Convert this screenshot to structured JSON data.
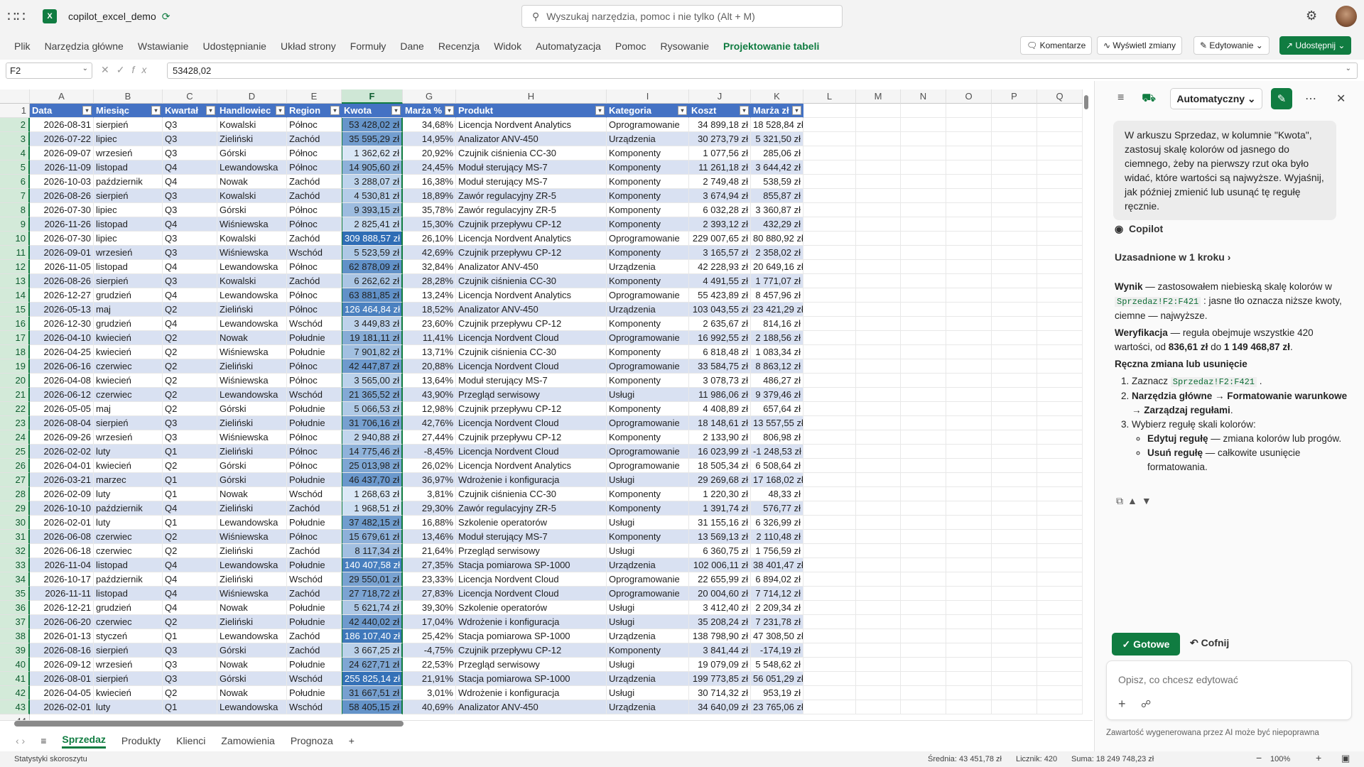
{
  "app": {
    "title": "copilot_excel_demo",
    "search_placeholder": "Wyszukaj narzędzia, pomoc i nie tylko (Alt + M)"
  },
  "ribbon": {
    "tabs": [
      "Plik",
      "Narzędzia główne",
      "Wstawianie",
      "Udostępnianie",
      "Układ strony",
      "Formuły",
      "Dane",
      "Recenzja",
      "Widok",
      "Automatyzacja",
      "Pomoc",
      "Rysowanie",
      "Projektowanie tabeli"
    ],
    "active_tab": "Projektowanie tabeli",
    "comments": "Komentarze",
    "show_changes": "Wyświetl zmiany",
    "editing": "Edytowanie",
    "share": "Udostępnij"
  },
  "formula": {
    "name_box": "F2",
    "value": "53428,02"
  },
  "columns": [
    "A",
    "B",
    "C",
    "D",
    "E",
    "F",
    "G",
    "H",
    "I",
    "J",
    "K",
    "L",
    "M",
    "N",
    "O",
    "P",
    "Q"
  ],
  "headers": [
    "Data",
    "Miesiąc",
    "Kwartał",
    "Handlowiec",
    "Region",
    "Kwota",
    "Marża %",
    "Produkt",
    "Kategoria",
    "Koszt",
    "Marża zł"
  ],
  "rows": [
    [
      "2026-08-31",
      "sierpień",
      "Q3",
      "Kowalski",
      "Północ",
      "53 428,02 zł",
      "34,68%",
      "Licencja Nordvent Analytics",
      "Oprogramowanie",
      "34 899,18 zł",
      "18 528,84 zł"
    ],
    [
      "2026-07-22",
      "lipiec",
      "Q3",
      "Zieliński",
      "Zachód",
      "35 595,29 zł",
      "14,95%",
      "Analizator ANV-450",
      "Urządzenia",
      "30 273,79 zł",
      "5 321,50 zł"
    ],
    [
      "2026-09-07",
      "wrzesień",
      "Q3",
      "Górski",
      "Północ",
      "1 362,62 zł",
      "20,92%",
      "Czujnik ciśnienia CC-30",
      "Komponenty",
      "1 077,56 zł",
      "285,06 zł"
    ],
    [
      "2026-11-09",
      "listopad",
      "Q4",
      "Lewandowska",
      "Północ",
      "14 905,60 zł",
      "24,45%",
      "Moduł sterujący MS-7",
      "Komponenty",
      "11 261,18 zł",
      "3 644,42 zł"
    ],
    [
      "2026-10-03",
      "październik",
      "Q4",
      "Nowak",
      "Zachód",
      "3 288,07 zł",
      "16,38%",
      "Moduł sterujący MS-7",
      "Komponenty",
      "2 749,48 zł",
      "538,59 zł"
    ],
    [
      "2026-08-26",
      "sierpień",
      "Q3",
      "Kowalski",
      "Zachód",
      "4 530,81 zł",
      "18,89%",
      "Zawór regulacyjny ZR-5",
      "Komponenty",
      "3 674,94 zł",
      "855,87 zł"
    ],
    [
      "2026-07-30",
      "lipiec",
      "Q3",
      "Górski",
      "Północ",
      "9 393,15 zł",
      "35,78%",
      "Zawór regulacyjny ZR-5",
      "Komponenty",
      "6 032,28 zł",
      "3 360,87 zł"
    ],
    [
      "2026-11-26",
      "listopad",
      "Q4",
      "Wiśniewska",
      "Północ",
      "2 825,41 zł",
      "15,30%",
      "Czujnik przepływu CP-12",
      "Komponenty",
      "2 393,12 zł",
      "432,29 zł"
    ],
    [
      "2026-07-30",
      "lipiec",
      "Q3",
      "Kowalski",
      "Zachód",
      "309 888,57 zł",
      "26,10%",
      "Licencja Nordvent Analytics",
      "Oprogramowanie",
      "229 007,65 zł",
      "80 880,92 zł"
    ],
    [
      "2026-09-01",
      "wrzesień",
      "Q3",
      "Wiśniewska",
      "Wschód",
      "5 523,59 zł",
      "42,69%",
      "Czujnik przepływu CP-12",
      "Komponenty",
      "3 165,57 zł",
      "2 358,02 zł"
    ],
    [
      "2026-11-05",
      "listopad",
      "Q4",
      "Lewandowska",
      "Północ",
      "62 878,09 zł",
      "32,84%",
      "Analizator ANV-450",
      "Urządzenia",
      "42 228,93 zł",
      "20 649,16 zł"
    ],
    [
      "2026-08-26",
      "sierpień",
      "Q3",
      "Kowalski",
      "Zachód",
      "6 262,62 zł",
      "28,28%",
      "Czujnik ciśnienia CC-30",
      "Komponenty",
      "4 491,55 zł",
      "1 771,07 zł"
    ],
    [
      "2026-12-27",
      "grudzień",
      "Q4",
      "Lewandowska",
      "Północ",
      "63 881,85 zł",
      "13,24%",
      "Licencja Nordvent Analytics",
      "Oprogramowanie",
      "55 423,89 zł",
      "8 457,96 zł"
    ],
    [
      "2026-05-13",
      "maj",
      "Q2",
      "Zieliński",
      "Północ",
      "126 464,84 zł",
      "18,52%",
      "Analizator ANV-450",
      "Urządzenia",
      "103 043,55 zł",
      "23 421,29 zł"
    ],
    [
      "2026-12-30",
      "grudzień",
      "Q4",
      "Lewandowska",
      "Wschód",
      "3 449,83 zł",
      "23,60%",
      "Czujnik przepływu CP-12",
      "Komponenty",
      "2 635,67 zł",
      "814,16 zł"
    ],
    [
      "2026-04-10",
      "kwiecień",
      "Q2",
      "Nowak",
      "Południe",
      "19 181,11 zł",
      "11,41%",
      "Licencja Nordvent Cloud",
      "Oprogramowanie",
      "16 992,55 zł",
      "2 188,56 zł"
    ],
    [
      "2026-04-25",
      "kwiecień",
      "Q2",
      "Wiśniewska",
      "Południe",
      "7 901,82 zł",
      "13,71%",
      "Czujnik ciśnienia CC-30",
      "Komponenty",
      "6 818,48 zł",
      "1 083,34 zł"
    ],
    [
      "2026-06-16",
      "czerwiec",
      "Q2",
      "Zieliński",
      "Północ",
      "42 447,87 zł",
      "20,88%",
      "Licencja Nordvent Cloud",
      "Oprogramowanie",
      "33 584,75 zł",
      "8 863,12 zł"
    ],
    [
      "2026-04-08",
      "kwiecień",
      "Q2",
      "Wiśniewska",
      "Północ",
      "3 565,00 zł",
      "13,64%",
      "Moduł sterujący MS-7",
      "Komponenty",
      "3 078,73 zł",
      "486,27 zł"
    ],
    [
      "2026-06-12",
      "czerwiec",
      "Q2",
      "Lewandowska",
      "Wschód",
      "21 365,52 zł",
      "43,90%",
      "Przegląd serwisowy",
      "Usługi",
      "11 986,06 zł",
      "9 379,46 zł"
    ],
    [
      "2026-05-05",
      "maj",
      "Q2",
      "Górski",
      "Południe",
      "5 066,53 zł",
      "12,98%",
      "Czujnik przepływu CP-12",
      "Komponenty",
      "4 408,89 zł",
      "657,64 zł"
    ],
    [
      "2026-08-04",
      "sierpień",
      "Q3",
      "Zieliński",
      "Południe",
      "31 706,16 zł",
      "42,76%",
      "Licencja Nordvent Cloud",
      "Oprogramowanie",
      "18 148,61 zł",
      "13 557,55 zł"
    ],
    [
      "2026-09-26",
      "wrzesień",
      "Q3",
      "Wiśniewska",
      "Północ",
      "2 940,88 zł",
      "27,44%",
      "Czujnik przepływu CP-12",
      "Komponenty",
      "2 133,90 zł",
      "806,98 zł"
    ],
    [
      "2026-02-02",
      "luty",
      "Q1",
      "Zieliński",
      "Północ",
      "14 775,46 zł",
      "-8,45%",
      "Licencja Nordvent Cloud",
      "Oprogramowanie",
      "16 023,99 zł",
      "-1 248,53 zł"
    ],
    [
      "2026-04-01",
      "kwiecień",
      "Q2",
      "Górski",
      "Północ",
      "25 013,98 zł",
      "26,02%",
      "Licencja Nordvent Analytics",
      "Oprogramowanie",
      "18 505,34 zł",
      "6 508,64 zł"
    ],
    [
      "2026-03-21",
      "marzec",
      "Q1",
      "Górski",
      "Południe",
      "46 437,70 zł",
      "36,97%",
      "Wdrożenie i konfiguracja",
      "Usługi",
      "29 269,68 zł",
      "17 168,02 zł"
    ],
    [
      "2026-02-09",
      "luty",
      "Q1",
      "Nowak",
      "Wschód",
      "1 268,63 zł",
      "3,81%",
      "Czujnik ciśnienia CC-30",
      "Komponenty",
      "1 220,30 zł",
      "48,33 zł"
    ],
    [
      "2026-10-10",
      "październik",
      "Q4",
      "Zieliński",
      "Zachód",
      "1 968,51 zł",
      "29,30%",
      "Zawór regulacyjny ZR-5",
      "Komponenty",
      "1 391,74 zł",
      "576,77 zł"
    ],
    [
      "2026-02-01",
      "luty",
      "Q1",
      "Lewandowska",
      "Południe",
      "37 482,15 zł",
      "16,88%",
      "Szkolenie operatorów",
      "Usługi",
      "31 155,16 zł",
      "6 326,99 zł"
    ],
    [
      "2026-06-08",
      "czerwiec",
      "Q2",
      "Wiśniewska",
      "Północ",
      "15 679,61 zł",
      "13,46%",
      "Moduł sterujący MS-7",
      "Komponenty",
      "13 569,13 zł",
      "2 110,48 zł"
    ],
    [
      "2026-06-18",
      "czerwiec",
      "Q2",
      "Zieliński",
      "Zachód",
      "8 117,34 zł",
      "21,64%",
      "Przegląd serwisowy",
      "Usługi",
      "6 360,75 zł",
      "1 756,59 zł"
    ],
    [
      "2026-11-04",
      "listopad",
      "Q4",
      "Lewandowska",
      "Południe",
      "140 407,58 zł",
      "27,35%",
      "Stacja pomiarowa SP-1000",
      "Urządzenia",
      "102 006,11 zł",
      "38 401,47 zł"
    ],
    [
      "2026-10-17",
      "październik",
      "Q4",
      "Zieliński",
      "Wschód",
      "29 550,01 zł",
      "23,33%",
      "Licencja Nordvent Cloud",
      "Oprogramowanie",
      "22 655,99 zł",
      "6 894,02 zł"
    ],
    [
      "2026-11-11",
      "listopad",
      "Q4",
      "Wiśniewska",
      "Zachód",
      "27 718,72 zł",
      "27,83%",
      "Licencja Nordvent Cloud",
      "Oprogramowanie",
      "20 004,60 zł",
      "7 714,12 zł"
    ],
    [
      "2026-12-21",
      "grudzień",
      "Q4",
      "Nowak",
      "Południe",
      "5 621,74 zł",
      "39,30%",
      "Szkolenie operatorów",
      "Usługi",
      "3 412,40 zł",
      "2 209,34 zł"
    ],
    [
      "2026-06-20",
      "czerwiec",
      "Q2",
      "Zieliński",
      "Południe",
      "42 440,02 zł",
      "17,04%",
      "Wdrożenie i konfiguracja",
      "Usługi",
      "35 208,24 zł",
      "7 231,78 zł"
    ],
    [
      "2026-01-13",
      "styczeń",
      "Q1",
      "Lewandowska",
      "Zachód",
      "186 107,40 zł",
      "25,42%",
      "Stacja pomiarowa SP-1000",
      "Urządzenia",
      "138 798,90 zł",
      "47 308,50 zł"
    ],
    [
      "2026-08-16",
      "sierpień",
      "Q3",
      "Górski",
      "Zachód",
      "3 667,25 zł",
      "-4,75%",
      "Czujnik przepływu CP-12",
      "Komponenty",
      "3 841,44 zł",
      "-174,19 zł"
    ],
    [
      "2026-09-12",
      "wrzesień",
      "Q3",
      "Nowak",
      "Południe",
      "24 627,71 zł",
      "22,53%",
      "Przegląd serwisowy",
      "Usługi",
      "19 079,09 zł",
      "5 548,62 zł"
    ],
    [
      "2026-08-01",
      "sierpień",
      "Q3",
      "Górski",
      "Wschód",
      "255 825,14 zł",
      "21,91%",
      "Stacja pomiarowa SP-1000",
      "Urządzenia",
      "199 773,85 zł",
      "56 051,29 zł"
    ],
    [
      "2026-04-05",
      "kwiecień",
      "Q2",
      "Nowak",
      "Południe",
      "31 667,51 zł",
      "3,01%",
      "Wdrożenie i konfiguracja",
      "Usługi",
      "30 714,32 zł",
      "953,19 zł"
    ],
    [
      "2026-02-01",
      "luty",
      "Q1",
      "Lewandowska",
      "Wschód",
      "58 405,15 zł",
      "40,69%",
      "Analizator ANV-450",
      "Urządzenia",
      "34 640,09 zł",
      "23 765,06 zł"
    ]
  ],
  "sheets": {
    "tabs": [
      "Sprzedaz",
      "Produkty",
      "Klienci",
      "Zamowienia",
      "Prognoza"
    ],
    "active": "Sprzedaz"
  },
  "status": {
    "left": "Statystyki skoroszytu",
    "average": "Średnia: 43 451,78 zł",
    "count": "Licznik: 420",
    "sum": "Suma: 18 249 748,23 zł",
    "zoom": "100%"
  },
  "copilot": {
    "mode": "Automatyczny",
    "user_message": "W arkuszu Sprzedaz, w kolumnie \"Kwota\", zastosuj skalę kolorów od jasnego do ciemnego, żeby na pierwszy rzut oka było widać, które wartości są najwyższe. Wyjaśnij, jak później zmienić lub usunąć tę regułę ręcznie.",
    "label": "Copilot",
    "steps": "Uzasadnione w 1 kroku",
    "result_label": "Wynik",
    "result_text_1": " — zastosowałem niebieską skalę kolorów w ",
    "result_code": "Sprzedaz!F2:F421",
    "result_text_2": " : jasne tło oznacza niższe kwoty, ciemne — najwyższe.",
    "verify_label": "Weryfikacja",
    "verify_text_1": " — reguła obejmuje wszystkie 420 wartości, od ",
    "verify_min": "836,61 zł",
    "verify_mid": " do ",
    "verify_max": "1 149 468,87 zł",
    "verify_end": ".",
    "manual_heading": "Ręczna zmiana lub usunięcie",
    "step1_text": "Zaznacz ",
    "step1_code": "Sprzedaz!F2:F421",
    "step1_end": " .",
    "step2_a": "Narzędzia główne",
    "step2_b": " → ",
    "step2_c": "Formatowanie warunkowe",
    "step2_d": " → ",
    "step2_e": "Zarządzaj regułami",
    "step2_f": ".",
    "step3_text": "Wybierz regułę skali kolorów:",
    "sub1_label": "Edytuj regułę",
    "sub1_text": " — zmiana kolorów lub progów.",
    "sub2_label": "Usuń regułę",
    "sub2_text": " — całkowite usunięcie formatowania.",
    "done": "Gotowe",
    "undo": "Cofnij",
    "input_placeholder": "Opisz, co chcesz edytować",
    "disclaimer": "Zawartość wygenerowana przez AI może być niepoprawna"
  },
  "colors": {
    "accent": "#107c41",
    "table_header": "#4472c4",
    "band": "#d9e1f2",
    "scale_light": "#dce9f7",
    "scale_dark": "#2f6db5"
  }
}
